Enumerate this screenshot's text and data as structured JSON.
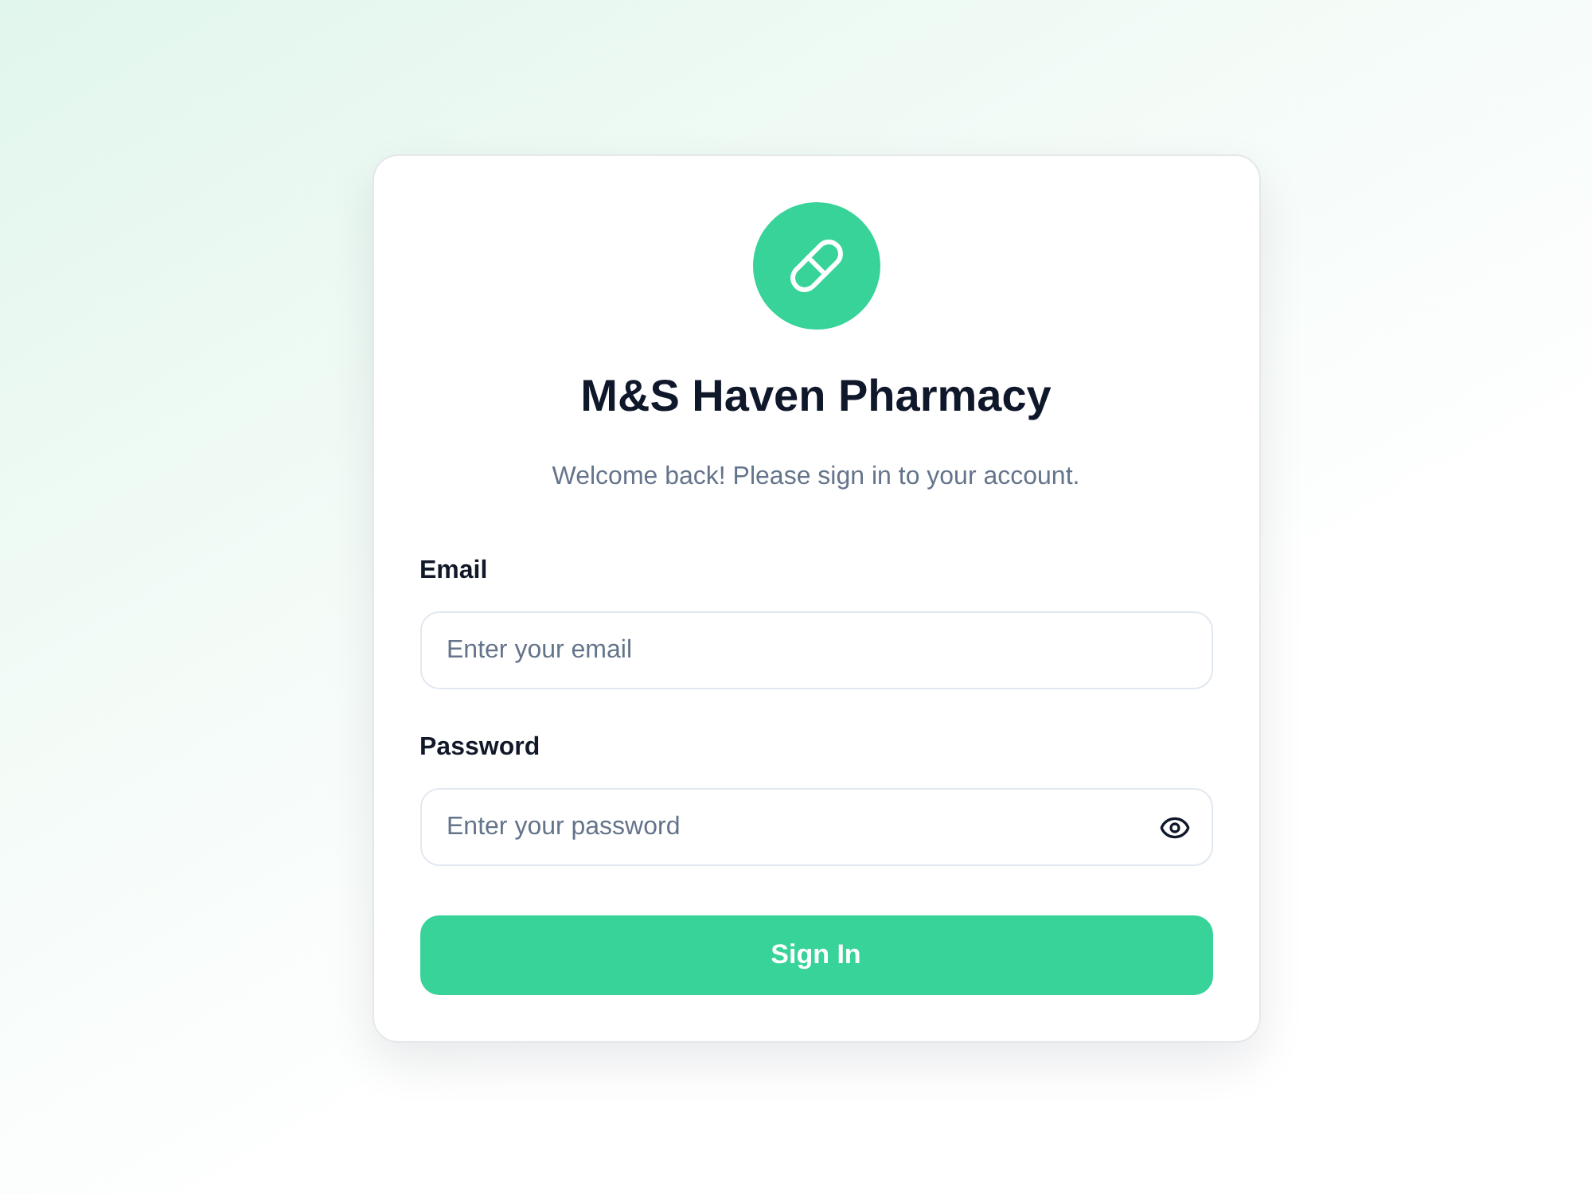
{
  "brand": {
    "name": "M&S Haven Pharmacy",
    "subtitle": "Welcome back! Please sign in to your account."
  },
  "fields": [
    {
      "kind": "email",
      "label": "Email",
      "placeholder": "Enter your email"
    },
    {
      "kind": "password",
      "label": "Password",
      "placeholder": "Enter your password"
    }
  ],
  "submit": {
    "label": "Sign In"
  }
}
